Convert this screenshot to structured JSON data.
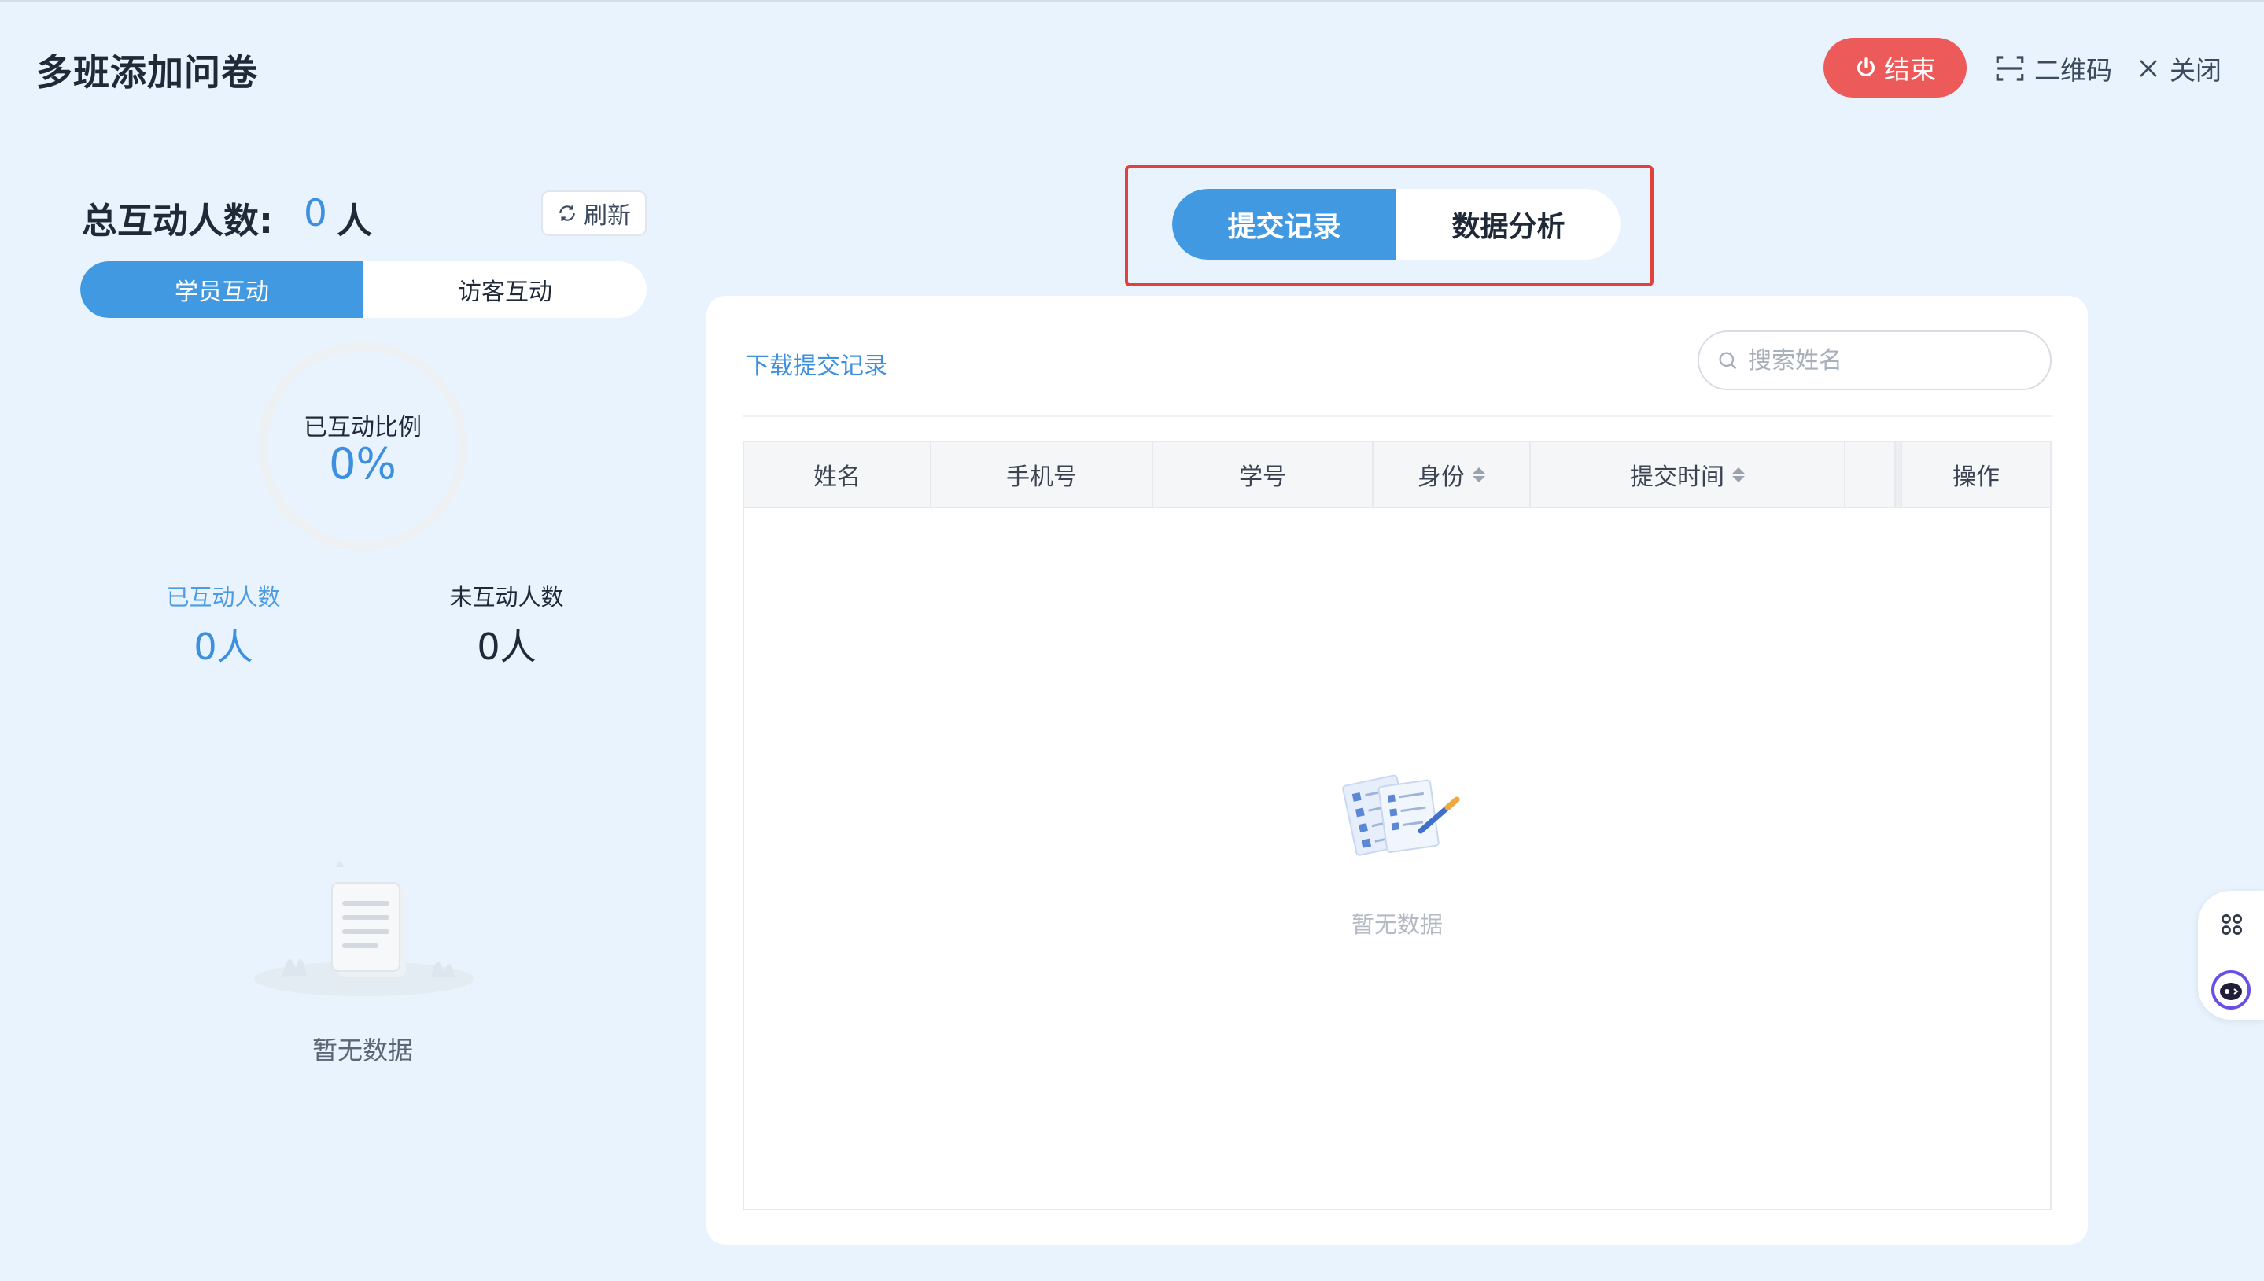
{
  "header": {
    "title": "多班添加问卷",
    "end_label": "结束",
    "qr_label": "二维码",
    "close_label": "关闭"
  },
  "left": {
    "total_label": "总互动人数:",
    "total_value": "0",
    "total_unit": "人",
    "refresh_label": "刷新",
    "tabs": [
      "学员互动",
      "访客互动"
    ],
    "ring_label": "已互动比例",
    "ring_value": "0%",
    "ring_fraction": 0,
    "interacted_label": "已互动人数",
    "interacted_value": "0人",
    "not_interacted_label": "未互动人数",
    "not_interacted_value": "0人",
    "empty_text": "暂无数据"
  },
  "center_tabs": [
    "提交记录",
    "数据分析"
  ],
  "main": {
    "download_label": "下载提交记录",
    "search_placeholder": "搜索姓名",
    "columns": [
      "姓名",
      "手机号",
      "学号",
      "身份",
      "提交时间",
      "操作"
    ],
    "rows": [],
    "empty_text": "暂无数据"
  },
  "colors": {
    "accent": "#4199e1",
    "end_button": "#ec5a5a",
    "highlight_outline": "#e0413b",
    "background": "#e8f3fd"
  }
}
